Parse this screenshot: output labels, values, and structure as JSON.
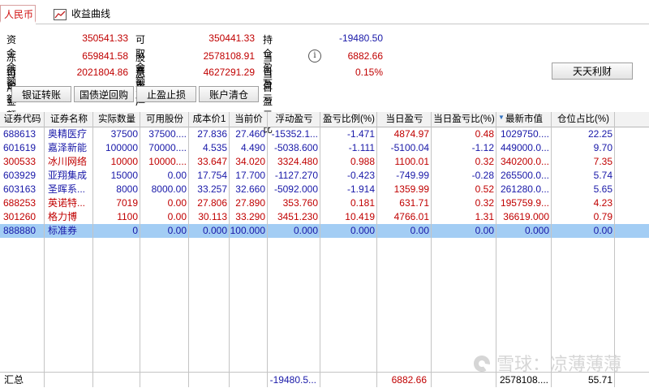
{
  "tabs": {
    "active": "人民币",
    "curve": "收益曲线"
  },
  "summary": {
    "funds_balance_label": "资金余额",
    "funds_balance": "350541.33",
    "withdrawable_label": "可取金额",
    "withdrawable": "350441.33",
    "holding_pl_label": "持仓盈亏",
    "holding_pl": "-19480.50",
    "frozen_label": "冻结金额",
    "frozen": "659841.58",
    "stock_value_label": "股票市值",
    "stock_value": "2578108.91",
    "today_pl_label": "当日盈亏",
    "today_pl": "6882.66",
    "available_label": "可用金额",
    "available": "2021804.86",
    "total_assets_label": "总 资 产",
    "total_assets": "4627291.29",
    "today_pl_ratio_label": "当日盈亏比",
    "today_pl_ratio": "0.15%"
  },
  "buttons": {
    "tiantian": "天天利财",
    "bank_transfer": "银证转账",
    "repo": "国债逆回购",
    "stop": "止盈止损",
    "clear": "账户清仓"
  },
  "table": {
    "headers": [
      "证券代码",
      "证券名称",
      "实际数量",
      "可用股份",
      "成本价1",
      "当前价",
      "浮动盈亏",
      "盈亏比例(%)",
      "当日盈亏",
      "当日盈亏比(%)",
      "最新市值",
      "仓位占比(%)"
    ],
    "rows": [
      [
        "688613",
        "奥精医疗",
        "37500",
        "37500....",
        "27.836",
        "27.460",
        "-15352.1...",
        "-1.471",
        "4874.97",
        "0.48",
        "1029750....",
        "22.25"
      ],
      [
        "601619",
        "嘉泽新能",
        "100000",
        "70000....",
        "4.535",
        "4.490",
        "-5038.600",
        "-1.111",
        "-5100.04",
        "-1.12",
        "449000.0...",
        "9.70"
      ],
      [
        "300533",
        "冰川网络",
        "10000",
        "10000....",
        "33.647",
        "34.020",
        "3324.480",
        "0.988",
        "1100.01",
        "0.32",
        "340200.0...",
        "7.35"
      ],
      [
        "603929",
        "亚翔集成",
        "15000",
        "0.00",
        "17.754",
        "17.700",
        "-1127.270",
        "-0.423",
        "-749.99",
        "-0.28",
        "265500.0...",
        "5.74"
      ],
      [
        "603163",
        "圣晖系...",
        "8000",
        "8000.00",
        "33.257",
        "32.660",
        "-5092.000",
        "-1.914",
        "1359.99",
        "0.52",
        "261280.0...",
        "5.65"
      ],
      [
        "688253",
        "英诺特...",
        "7019",
        "0.00",
        "27.806",
        "27.890",
        "353.760",
        "0.181",
        "631.71",
        "0.32",
        "195759.9...",
        "4.23"
      ],
      [
        "301260",
        "格力博",
        "1100",
        "0.00",
        "30.113",
        "33.290",
        "3451.230",
        "10.419",
        "4766.01",
        "1.31",
        "36619.000",
        "0.79"
      ],
      [
        "888880",
        "标准券",
        "0",
        "0.00",
        "0.000",
        "100.000",
        "0.000",
        "0.000",
        "0.00",
        "0.00",
        "0.000",
        "0.00"
      ]
    ],
    "sum_label": "汇总",
    "sum_float_pl": "-19480.5...",
    "sum_today_pl": "6882.66",
    "sum_market_value": "2578108....",
    "sum_position": "55.71"
  },
  "watermark": "雪球：凉薄薄薄"
}
